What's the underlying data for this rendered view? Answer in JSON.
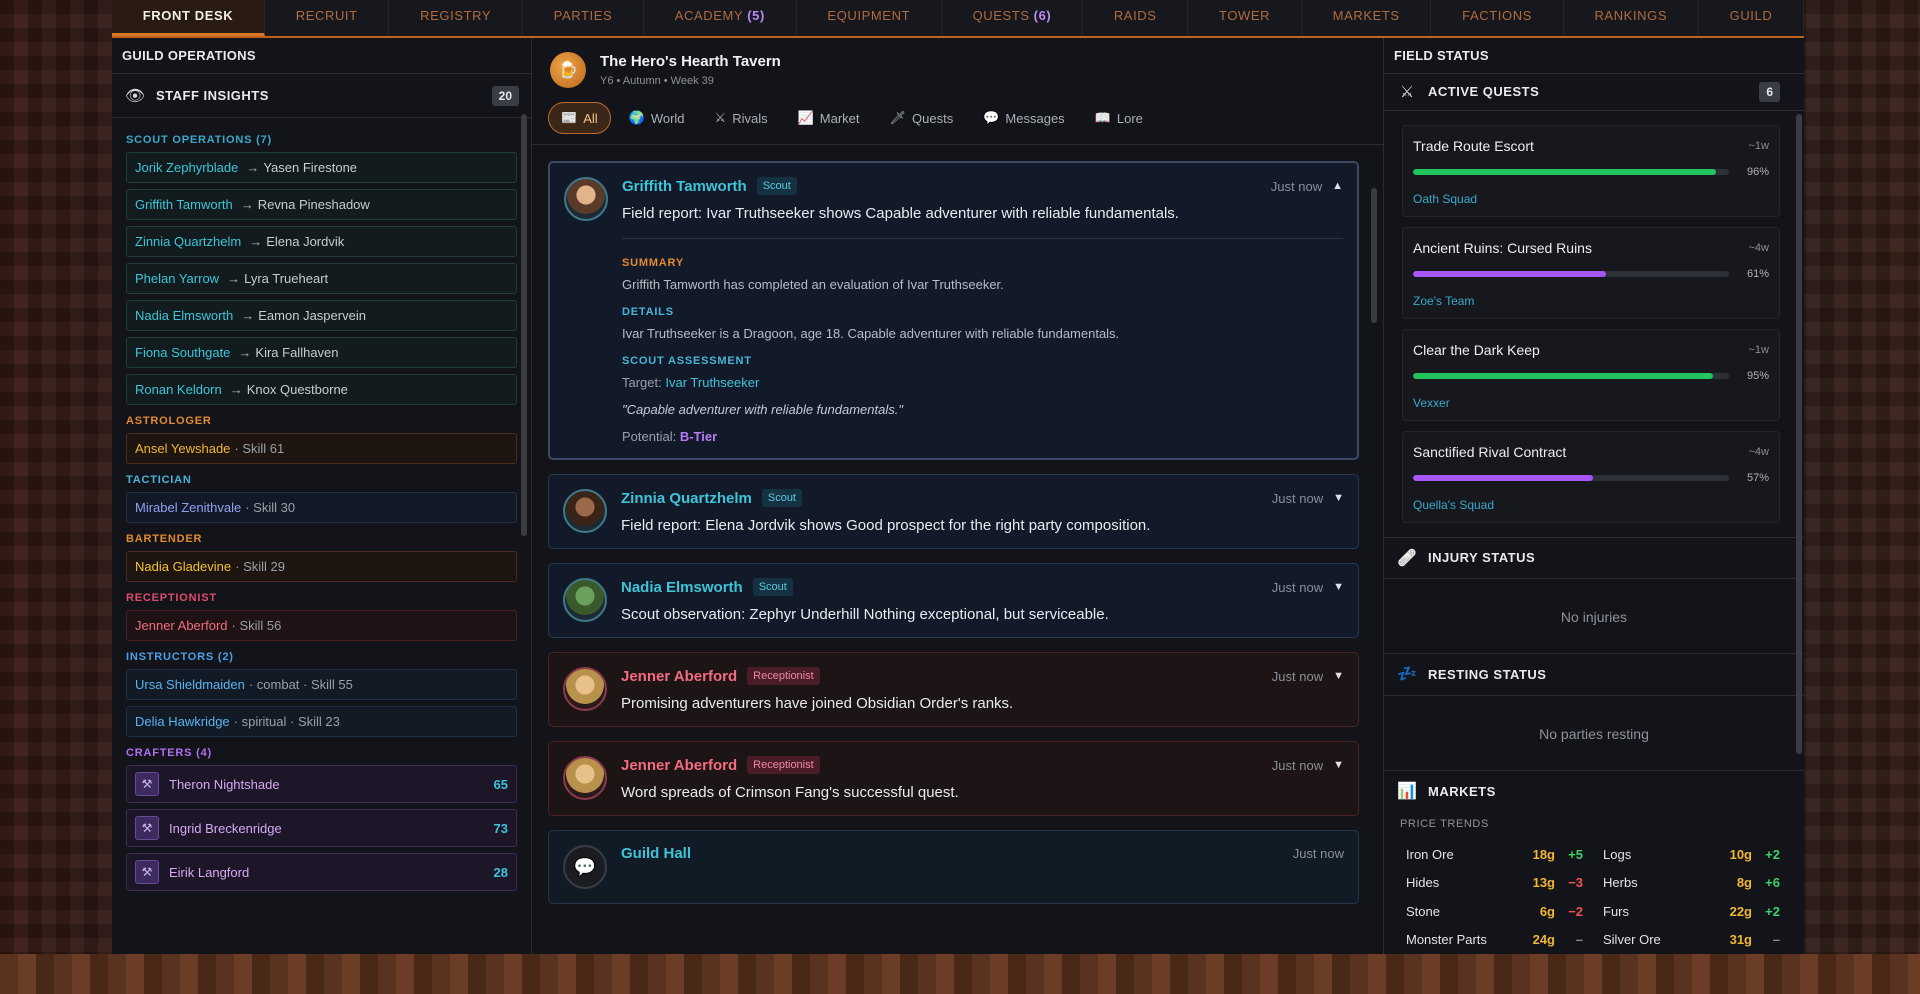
{
  "nav": {
    "tabs": [
      {
        "label": "FRONT DESK",
        "active": true
      },
      {
        "label": "RECRUIT"
      },
      {
        "label": "REGISTRY"
      },
      {
        "label": "PARTIES"
      },
      {
        "label": "ACADEMY",
        "count": "(5)"
      },
      {
        "label": "EQUIPMENT"
      },
      {
        "label": "QUESTS",
        "count": "(6)"
      },
      {
        "label": "RAIDS"
      },
      {
        "label": "TOWER"
      },
      {
        "label": "MARKETS"
      },
      {
        "label": "FACTIONS"
      },
      {
        "label": "RANKINGS"
      },
      {
        "label": "GUILD"
      }
    ]
  },
  "left": {
    "title": "GUILD OPERATIONS",
    "staff_title": "STAFF INSIGHTS",
    "staff_count": "20",
    "scout_label": "SCOUT OPERATIONS (7)",
    "scouts": [
      {
        "scout": "Jorik Zephyrblade",
        "target": "Yasen Firestone"
      },
      {
        "scout": "Griffith Tamworth",
        "target": "Revna Pineshadow"
      },
      {
        "scout": "Zinnia Quartzhelm",
        "target": "Elena Jordvik"
      },
      {
        "scout": "Phelan Yarrow",
        "target": "Lyra Trueheart"
      },
      {
        "scout": "Nadia Elmsworth",
        "target": "Eamon Jaspervein"
      },
      {
        "scout": "Fiona Southgate",
        "target": "Kira Fallhaven"
      },
      {
        "scout": "Ronan Keldorn",
        "target": "Knox Questborne"
      }
    ],
    "arrow": "→",
    "astrologer_label": "ASTROLOGER",
    "astrologer": {
      "name": "Ansel Yewshade",
      "meta": "· Skill 61"
    },
    "tactician_label": "TACTICIAN",
    "tactician": {
      "name": "Mirabel Zenithvale",
      "meta": "· Skill 30"
    },
    "bartender_label": "BARTENDER",
    "bartender": {
      "name": "Nadia Gladevine",
      "meta": "· Skill 29"
    },
    "receptionist_label": "RECEPTIONIST",
    "receptionist": {
      "name": "Jenner Aberford",
      "meta": "· Skill 56"
    },
    "instructors_label": "INSTRUCTORS (2)",
    "instructors": [
      {
        "name": "Ursa Shieldmaiden",
        "meta": "· combat · Skill 55"
      },
      {
        "name": "Delia Hawkridge",
        "meta": "· spiritual · Skill 23"
      }
    ],
    "crafters_label": "CRAFTERS (4)",
    "crafters": [
      {
        "name": "Theron Nightshade",
        "skill": "65"
      },
      {
        "name": "Ingrid Breckenridge",
        "skill": "73"
      },
      {
        "name": "Eirik Langford",
        "skill": "28"
      }
    ]
  },
  "center": {
    "tavern_name": "The Hero's Hearth Tavern",
    "tavern_sub": "Y6 • Autumn • Week 39",
    "filters": [
      {
        "icon": "📰",
        "label": "All",
        "active": true
      },
      {
        "icon": "🌍",
        "label": "World"
      },
      {
        "icon": "⚔",
        "label": "Rivals"
      },
      {
        "icon": "📈",
        "label": "Market"
      },
      {
        "icon": "🗡",
        "label": "Quests"
      },
      {
        "icon": "💬",
        "label": "Messages"
      },
      {
        "icon": "📖",
        "label": "Lore"
      }
    ],
    "feed": [
      {
        "name": "Griffith Tamworth",
        "tag": "Scout",
        "time": "Just now",
        "caret": "▲",
        "msg": "Field report: Ivar Truthseeker shows Capable adventurer with reliable fundamentals.",
        "summary_label": "SUMMARY",
        "summary": "Griffith Tamworth has completed an evaluation of Ivar Truthseeker.",
        "details_label": "DETAILS",
        "details": "Ivar Truthseeker is a Dragoon, age 18. Capable adventurer with reliable fundamentals.",
        "assessment_label": "SCOUT ASSESSMENT",
        "target_label": "Target:",
        "target": "Ivar Truthseeker",
        "quote": "\"Capable adventurer with reliable fundamentals.\"",
        "potential_label": "Potential:",
        "potential": "B-Tier"
      },
      {
        "name": "Zinnia Quartzhelm",
        "tag": "Scout",
        "time": "Just now",
        "caret": "▼",
        "msg": "Field report: Elena Jordvik shows Good prospect for the right party composition."
      },
      {
        "name": "Nadia Elmsworth",
        "tag": "Scout",
        "time": "Just now",
        "caret": "▼",
        "msg": "Scout observation: Zephyr Underhill Nothing exceptional, but serviceable."
      },
      {
        "name": "Jenner Aberford",
        "tag": "Receptionist",
        "time": "Just now",
        "caret": "▼",
        "msg": "Promising adventurers have joined Obsidian Order's ranks."
      },
      {
        "name": "Jenner Aberford",
        "tag": "Receptionist",
        "time": "Just now",
        "caret": "▼",
        "msg": "Word spreads of Crimson Fang's successful quest."
      },
      {
        "name": "Guild Hall",
        "time": "Just now"
      }
    ]
  },
  "right": {
    "title": "FIELD STATUS",
    "quests_title": "ACTIVE QUESTS",
    "quests_count": "6",
    "quests": [
      {
        "name": "Trade Route Escort",
        "eta": "~1w",
        "pct": "96%",
        "progress": 96,
        "party": "Oath Squad",
        "color": "#22c55e"
      },
      {
        "name": "Ancient Ruins: Cursed Ruins",
        "eta": "~4w",
        "pct": "61%",
        "progress": 61,
        "party": "Zoe's Team",
        "color": "#a855f7"
      },
      {
        "name": "Clear the Dark Keep",
        "eta": "~1w",
        "pct": "95%",
        "progress": 95,
        "party": "Vexxer",
        "color": "#22c55e"
      },
      {
        "name": "Sanctified Rival Contract",
        "eta": "~4w",
        "pct": "57%",
        "progress": 57,
        "party": "Quella's Squad",
        "color": "#a855f7"
      }
    ],
    "injury_title": "INJURY STATUS",
    "injury_empty": "No injuries",
    "resting_title": "RESTING STATUS",
    "resting_empty": "No parties resting",
    "markets_title": "MARKETS",
    "price_trends": "PRICE TRENDS",
    "prices": [
      {
        "name": "Iron Ore",
        "value": "18g",
        "delta": "+5",
        "dir": "up"
      },
      {
        "name": "Logs",
        "value": "10g",
        "delta": "+2",
        "dir": "up"
      },
      {
        "name": "Hides",
        "value": "13g",
        "delta": "−3",
        "dir": "down"
      },
      {
        "name": "Herbs",
        "value": "8g",
        "delta": "+6",
        "dir": "up"
      },
      {
        "name": "Stone",
        "value": "6g",
        "delta": "−2",
        "dir": "down"
      },
      {
        "name": "Furs",
        "value": "22g",
        "delta": "+2",
        "dir": "up"
      },
      {
        "name": "Monster Parts",
        "value": "24g",
        "delta": "–",
        "dir": "flat"
      },
      {
        "name": "Silver Ore",
        "value": "31g",
        "delta": "–",
        "dir": "flat"
      }
    ]
  },
  "colors": {
    "accent": "#d8762a",
    "scout_cyan": "#3ec4d6",
    "receptionist_pink": "#f26b80",
    "crafter_purple": "#d7a8f2",
    "price_gold": "#f1b634"
  }
}
